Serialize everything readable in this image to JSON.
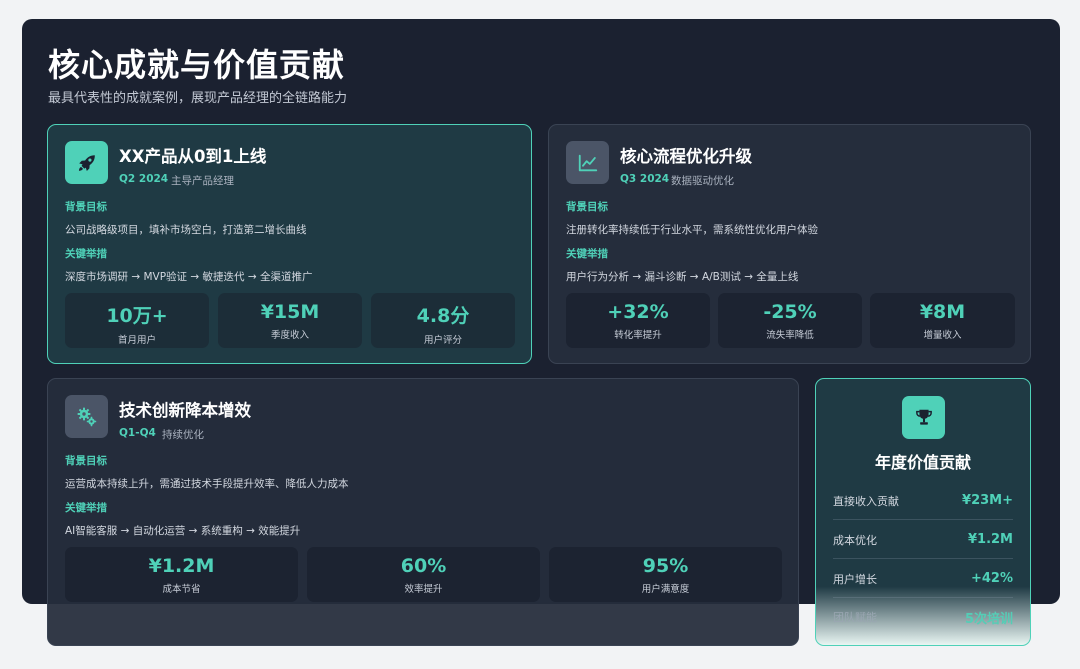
{
  "header": {
    "title": "核心成就与价值贡献",
    "subtitle": "最具代表性的成就案例，展现产品经理的全链路能力"
  },
  "cards": [
    {
      "icon": "rocket-icon",
      "title": "XX产品从0到1上线",
      "period": "Q2 2024",
      "role": "主导产品经理",
      "background_label": "背景目标",
      "background_text": "公司战略级项目，填补市场空白，打造第二增长曲线",
      "actions_label": "关键举措",
      "actions_text": "深度市场调研 → MVP验证 → 敏捷迭代 → 全渠道推广",
      "metrics": [
        {
          "value": "10万+",
          "label": "首月用户"
        },
        {
          "value": "¥15M",
          "label": "季度收入"
        },
        {
          "value": "4.8分",
          "label": "用户评分"
        }
      ]
    },
    {
      "icon": "chart-line-icon",
      "title": "核心流程优化升级",
      "period": "Q3 2024",
      "role": "数据驱动优化",
      "background_label": "背景目标",
      "background_text": "注册转化率持续低于行业水平，需系统性优化用户体验",
      "actions_label": "关键举措",
      "actions_text": "用户行为分析 → 漏斗诊断 → A/B测试 → 全量上线",
      "metrics": [
        {
          "value": "+32%",
          "label": "转化率提升"
        },
        {
          "value": "-25%",
          "label": "流失率降低"
        },
        {
          "value": "¥8M",
          "label": "增量收入"
        }
      ]
    },
    {
      "icon": "gears-icon",
      "title": "技术创新降本增效",
      "period": "Q1-Q4",
      "role": "持续优化",
      "background_label": "背景目标",
      "background_text": "运营成本持续上升，需通过技术手段提升效率、降低人力成本",
      "actions_label": "关键举措",
      "actions_text": "AI智能客服 → 自动化运营 → 系统重构 → 效能提升",
      "metrics": [
        {
          "value": "¥1.2M",
          "label": "成本节省"
        },
        {
          "value": "60%",
          "label": "效率提升"
        },
        {
          "value": "95%",
          "label": "用户满意度"
        }
      ]
    }
  ],
  "value_card": {
    "icon": "trophy-icon",
    "title": "年度价值贡献",
    "rows": [
      {
        "label": "直接收入贡献",
        "value": "¥23M+"
      },
      {
        "label": "成本优化",
        "value": "¥1.2M"
      },
      {
        "label": "用户增长",
        "value": "+42%"
      },
      {
        "label": "团队赋能",
        "value": "5次培训"
      }
    ]
  },
  "colors": {
    "accent": "#4fd1b8",
    "slide_bg": "#1b2130",
    "card_bg": "#252d3c",
    "page_bg": "#f2f3f5"
  }
}
